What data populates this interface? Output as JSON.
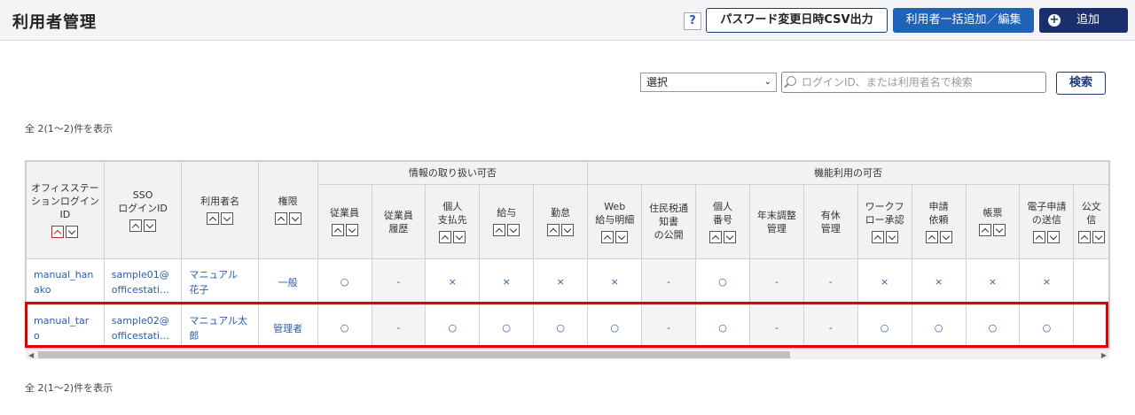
{
  "header": {
    "title": "利用者管理",
    "help_label": "?",
    "csv_label": "パスワード変更日時CSV出力",
    "bulk_label": "利用者一括追加／編集",
    "add_label": "追加",
    "add_icon": "plus-circle-icon"
  },
  "search": {
    "select_value": "選択",
    "placeholder": "ログインID、または利用者名で検索",
    "button_label": "検索"
  },
  "count_text": "全 2(1～2)件を表示",
  "table": {
    "group_headers": [
      "情報の取り扱い可否",
      "機能利用の可否"
    ],
    "fixed_headers": [
      "オフィスステーションログインID",
      "SSO\nログインID",
      "利用者名",
      "権限"
    ],
    "info_headers": [
      "従業員",
      "従業員\n履歴",
      "個人\n支払先",
      "給与",
      "勤怠"
    ],
    "func_headers": [
      "Web\n給与明細",
      "住民税通\n知書\nの公開",
      "個人\n番号",
      "年末調整\n管理",
      "有休\n管理",
      "ワークフ\nロー承認",
      "申請\n依頼",
      "帳票",
      "電子申請\nの送信",
      "公文\n信"
    ],
    "rows": [
      {
        "login_id": "manual_han\nako",
        "sso_id": "sample01@\nofficestati…",
        "name": "マニュアル\n花子",
        "role": "一般",
        "cells": [
          "○",
          "-",
          "×",
          "×",
          "×",
          "×",
          "-",
          "○",
          "-",
          "-",
          "×",
          "×",
          "×",
          "×",
          ""
        ]
      },
      {
        "login_id": "manual_tar\no",
        "sso_id": "sample02@\nofficestati…",
        "name": "マニュアル太\n郎",
        "role": "管理者",
        "cells": [
          "○",
          "-",
          "○",
          "○",
          "○",
          "○",
          "-",
          "○",
          "-",
          "-",
          "○",
          "○",
          "○",
          "○",
          ""
        ]
      }
    ]
  },
  "colors": {
    "accent": "#1f62b8",
    "dark": "#1b2f6e",
    "highlight": "#e00000",
    "link": "#2a5db0"
  }
}
